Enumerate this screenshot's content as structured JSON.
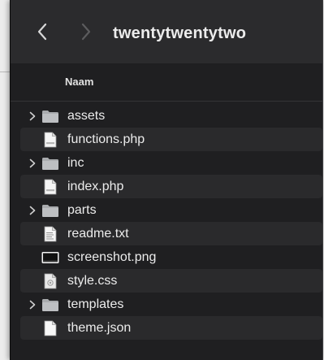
{
  "window": {
    "title": "twentytwentytwo"
  },
  "toolbar": {
    "back_icon": "chevron-left-icon",
    "forward_icon": "chevron-right-icon"
  },
  "list": {
    "column_header": "Naam",
    "items": [
      {
        "name": "assets",
        "kind": "folder",
        "icon": "folder-icon"
      },
      {
        "name": "functions.php",
        "kind": "file",
        "icon": "php-file-icon"
      },
      {
        "name": "inc",
        "kind": "folder",
        "icon": "folder-icon"
      },
      {
        "name": "index.php",
        "kind": "file",
        "icon": "php-file-icon"
      },
      {
        "name": "parts",
        "kind": "folder",
        "icon": "folder-icon"
      },
      {
        "name": "readme.txt",
        "kind": "file",
        "icon": "text-file-icon"
      },
      {
        "name": "screenshot.png",
        "kind": "image",
        "icon": "image-file-icon"
      },
      {
        "name": "style.css",
        "kind": "file",
        "icon": "css-file-icon"
      },
      {
        "name": "templates",
        "kind": "folder",
        "icon": "folder-icon"
      },
      {
        "name": "theme.json",
        "kind": "file",
        "icon": "json-file-icon"
      }
    ]
  },
  "colors": {
    "window_bg": "#1f1f21",
    "toolbar_bg": "#2b2b2d",
    "alt_row_bg": "#2a2a2c",
    "text": "#ececec",
    "folder": "#a9abae"
  }
}
